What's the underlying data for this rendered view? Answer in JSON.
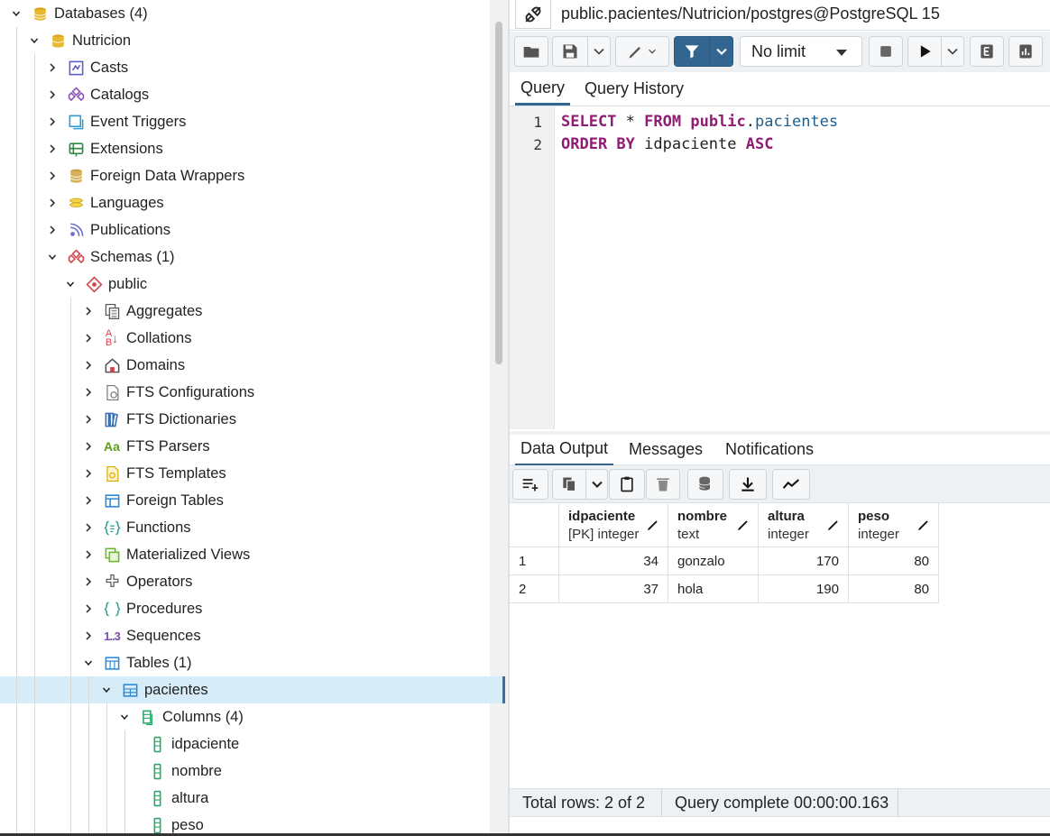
{
  "tree": {
    "items": [
      {
        "label": "Databases (4)",
        "icon": "databases-icon"
      },
      {
        "label": "Nutricion",
        "icon": "database-icon"
      },
      {
        "label": "Casts",
        "icon": "casts-icon"
      },
      {
        "label": "Catalogs",
        "icon": "catalogs-icon"
      },
      {
        "label": "Event Triggers",
        "icon": "event-triggers-icon"
      },
      {
        "label": "Extensions",
        "icon": "extensions-icon"
      },
      {
        "label": "Foreign Data Wrappers",
        "icon": "foreign-data-wrappers-icon"
      },
      {
        "label": "Languages",
        "icon": "languages-icon"
      },
      {
        "label": "Publications",
        "icon": "publications-icon"
      },
      {
        "label": "Schemas (1)",
        "icon": "schemas-icon"
      },
      {
        "label": "public",
        "icon": "schema-icon"
      },
      {
        "label": "Aggregates",
        "icon": "aggregates-icon"
      },
      {
        "label": "Collations",
        "icon": "collations-icon"
      },
      {
        "label": "Domains",
        "icon": "domains-icon"
      },
      {
        "label": "FTS Configurations",
        "icon": "fts-configurations-icon"
      },
      {
        "label": "FTS Dictionaries",
        "icon": "fts-dictionaries-icon"
      },
      {
        "label": "FTS Parsers",
        "icon": "fts-parsers-icon"
      },
      {
        "label": "FTS Templates",
        "icon": "fts-templates-icon"
      },
      {
        "label": "Foreign Tables",
        "icon": "foreign-tables-icon"
      },
      {
        "label": "Functions",
        "icon": "functions-icon"
      },
      {
        "label": "Materialized Views",
        "icon": "materialized-views-icon"
      },
      {
        "label": "Operators",
        "icon": "operators-icon"
      },
      {
        "label": "Procedures",
        "icon": "procedures-icon"
      },
      {
        "label": "Sequences",
        "icon": "sequences-icon"
      },
      {
        "label": "Tables (1)",
        "icon": "tables-icon"
      },
      {
        "label": "pacientes",
        "icon": "table-icon"
      },
      {
        "label": "Columns (4)",
        "icon": "columns-icon"
      },
      {
        "label": "idpaciente",
        "icon": "column-icon"
      },
      {
        "label": "nombre",
        "icon": "column-icon"
      },
      {
        "label": "altura",
        "icon": "column-icon"
      },
      {
        "label": "peso",
        "icon": "column-icon"
      }
    ],
    "fts_parsers_glyph": "Aa",
    "sequences_glyph": "1..3",
    "collations_glyph_top": "A",
    "collations_glyph_bottom": "B"
  },
  "connection": {
    "title": "public.pacientes/Nutricion/postgres@PostgreSQL 15"
  },
  "toolbar": {
    "limit_value": "No limit"
  },
  "query_tabs": [
    "Query",
    "Query History"
  ],
  "editor": {
    "line_numbers": [
      "1",
      "2"
    ],
    "line1": {
      "kw1": "SELECT",
      "star": " * ",
      "kw2": "FROM",
      "space": " ",
      "schema": "public",
      "dot": ".",
      "table": "pacientes"
    },
    "line2": {
      "kw1": "ORDER BY",
      "col": " idpaciente ",
      "kw2": "ASC"
    }
  },
  "result_tabs": [
    "Data Output",
    "Messages",
    "Notifications"
  ],
  "grid": {
    "columns": [
      {
        "name": "idpaciente",
        "type": "[PK] integer"
      },
      {
        "name": "nombre",
        "type": "text"
      },
      {
        "name": "altura",
        "type": "integer"
      },
      {
        "name": "peso",
        "type": "integer"
      }
    ],
    "rows": [
      {
        "n": "1",
        "idpaciente": "34",
        "nombre": "gonzalo",
        "altura": "170",
        "peso": "80"
      },
      {
        "n": "2",
        "idpaciente": "37",
        "nombre": "hola",
        "altura": "190",
        "peso": "80"
      }
    ]
  },
  "status": {
    "total_rows": "Total rows: 2 of 2",
    "query_complete": "Query complete 00:00:00.163"
  },
  "colors": {
    "accent": "#326690",
    "keyword": "#8f1d73",
    "identifier": "#1f5e8c",
    "selected_row": "#d6ecf9"
  }
}
